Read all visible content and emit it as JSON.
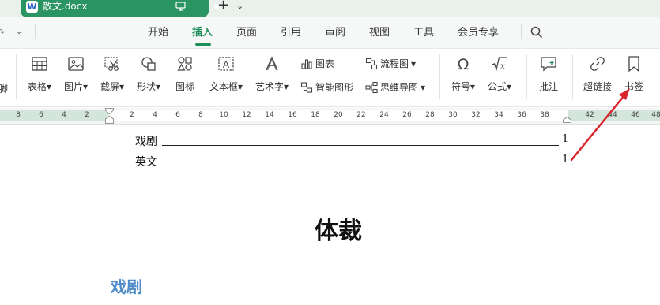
{
  "tab": {
    "filename": "散文.docx",
    "app_badge": "W"
  },
  "menu": {
    "items": [
      "开始",
      "插入",
      "页面",
      "引用",
      "审阅",
      "视图",
      "工具",
      "会员专享"
    ],
    "active": "插入"
  },
  "ribbon": {
    "edge_label": "脚",
    "table": "表格",
    "picture": "图片",
    "screenshot": "截屏",
    "shape": "形状",
    "icon": "图标",
    "textbox": "文本框",
    "wordart": "艺术字",
    "chart": "图表",
    "smartart": "智能图形",
    "flowchart": "流程图",
    "mindmap": "思维导图",
    "symbol": "符号",
    "formula": "公式",
    "comment": "批注",
    "hyperlink": "超链接",
    "bookmark": "书签",
    "dropdown_glyph": "▾"
  },
  "ruler": {
    "ticks": [
      "8",
      "6",
      "4",
      "2",
      "2",
      "4",
      "6",
      "8",
      "10",
      "12",
      "14",
      "16",
      "18",
      "20",
      "22",
      "24",
      "26",
      "28",
      "30",
      "32",
      "34",
      "36",
      "38",
      "42",
      "44",
      "46",
      "48"
    ]
  },
  "document": {
    "toc": [
      {
        "label": "戏剧",
        "page": "1"
      },
      {
        "label": "英文",
        "page": "1"
      }
    ],
    "heading": "体裁",
    "subheading": "戏剧"
  },
  "colors": {
    "accent": "#1e8e5a",
    "tab_bg": "#2a9462",
    "subheading": "#4f8ac9",
    "annotation_arrow": "#d9232a"
  }
}
